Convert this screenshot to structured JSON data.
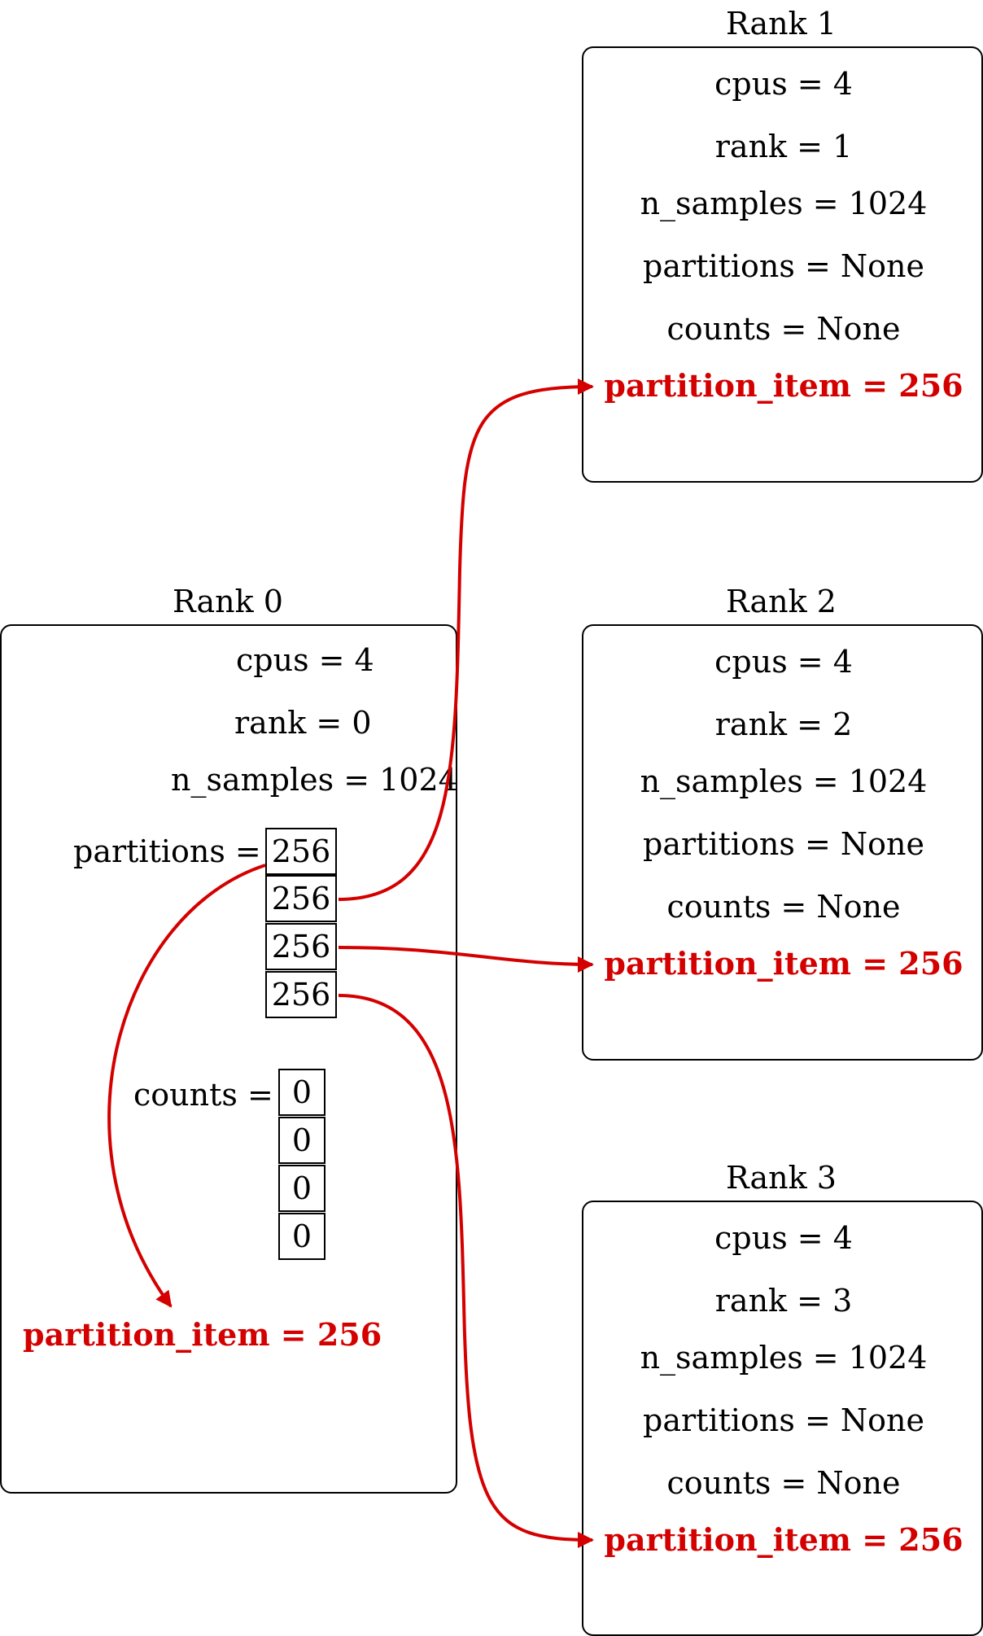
{
  "colors": {
    "highlight": "#d40000",
    "stroke": "#000000"
  },
  "rank0": {
    "title": "Rank 0",
    "cpus": "cpus = 4",
    "rank": "rank = 0",
    "n_samples": "n_samples = 1024",
    "partitions_label": "partitions =",
    "partitions": [
      "256",
      "256",
      "256",
      "256"
    ],
    "counts_label": "counts =",
    "counts": [
      "0",
      "0",
      "0",
      "0"
    ],
    "partition_item": "partition_item = 256"
  },
  "rank1": {
    "title": "Rank 1",
    "cpus": "cpus = 4",
    "rank": "rank = 1",
    "n_samples": "n_samples = 1024",
    "partitions": "partitions = None",
    "counts": "counts = None",
    "partition_item": "partition_item = 256"
  },
  "rank2": {
    "title": "Rank 2",
    "cpus": "cpus = 4",
    "rank": "rank = 2",
    "n_samples": "n_samples = 1024",
    "partitions": "partitions = None",
    "counts": "counts = None",
    "partition_item": "partition_item = 256"
  },
  "rank3": {
    "title": "Rank 3",
    "cpus": "cpus = 4",
    "rank": "rank = 3",
    "n_samples": "n_samples = 1024",
    "partitions": "partitions = None",
    "counts": "counts = None",
    "partition_item": "partition_item = 256"
  },
  "edges": [
    {
      "from": "rank0.partitions.0",
      "to": "rank0.partition_item"
    },
    {
      "from": "rank0.partitions.1",
      "to": "rank1.partition_item"
    },
    {
      "from": "rank0.partitions.2",
      "to": "rank2.partition_item"
    },
    {
      "from": "rank0.partitions.3",
      "to": "rank3.partition_item"
    }
  ]
}
